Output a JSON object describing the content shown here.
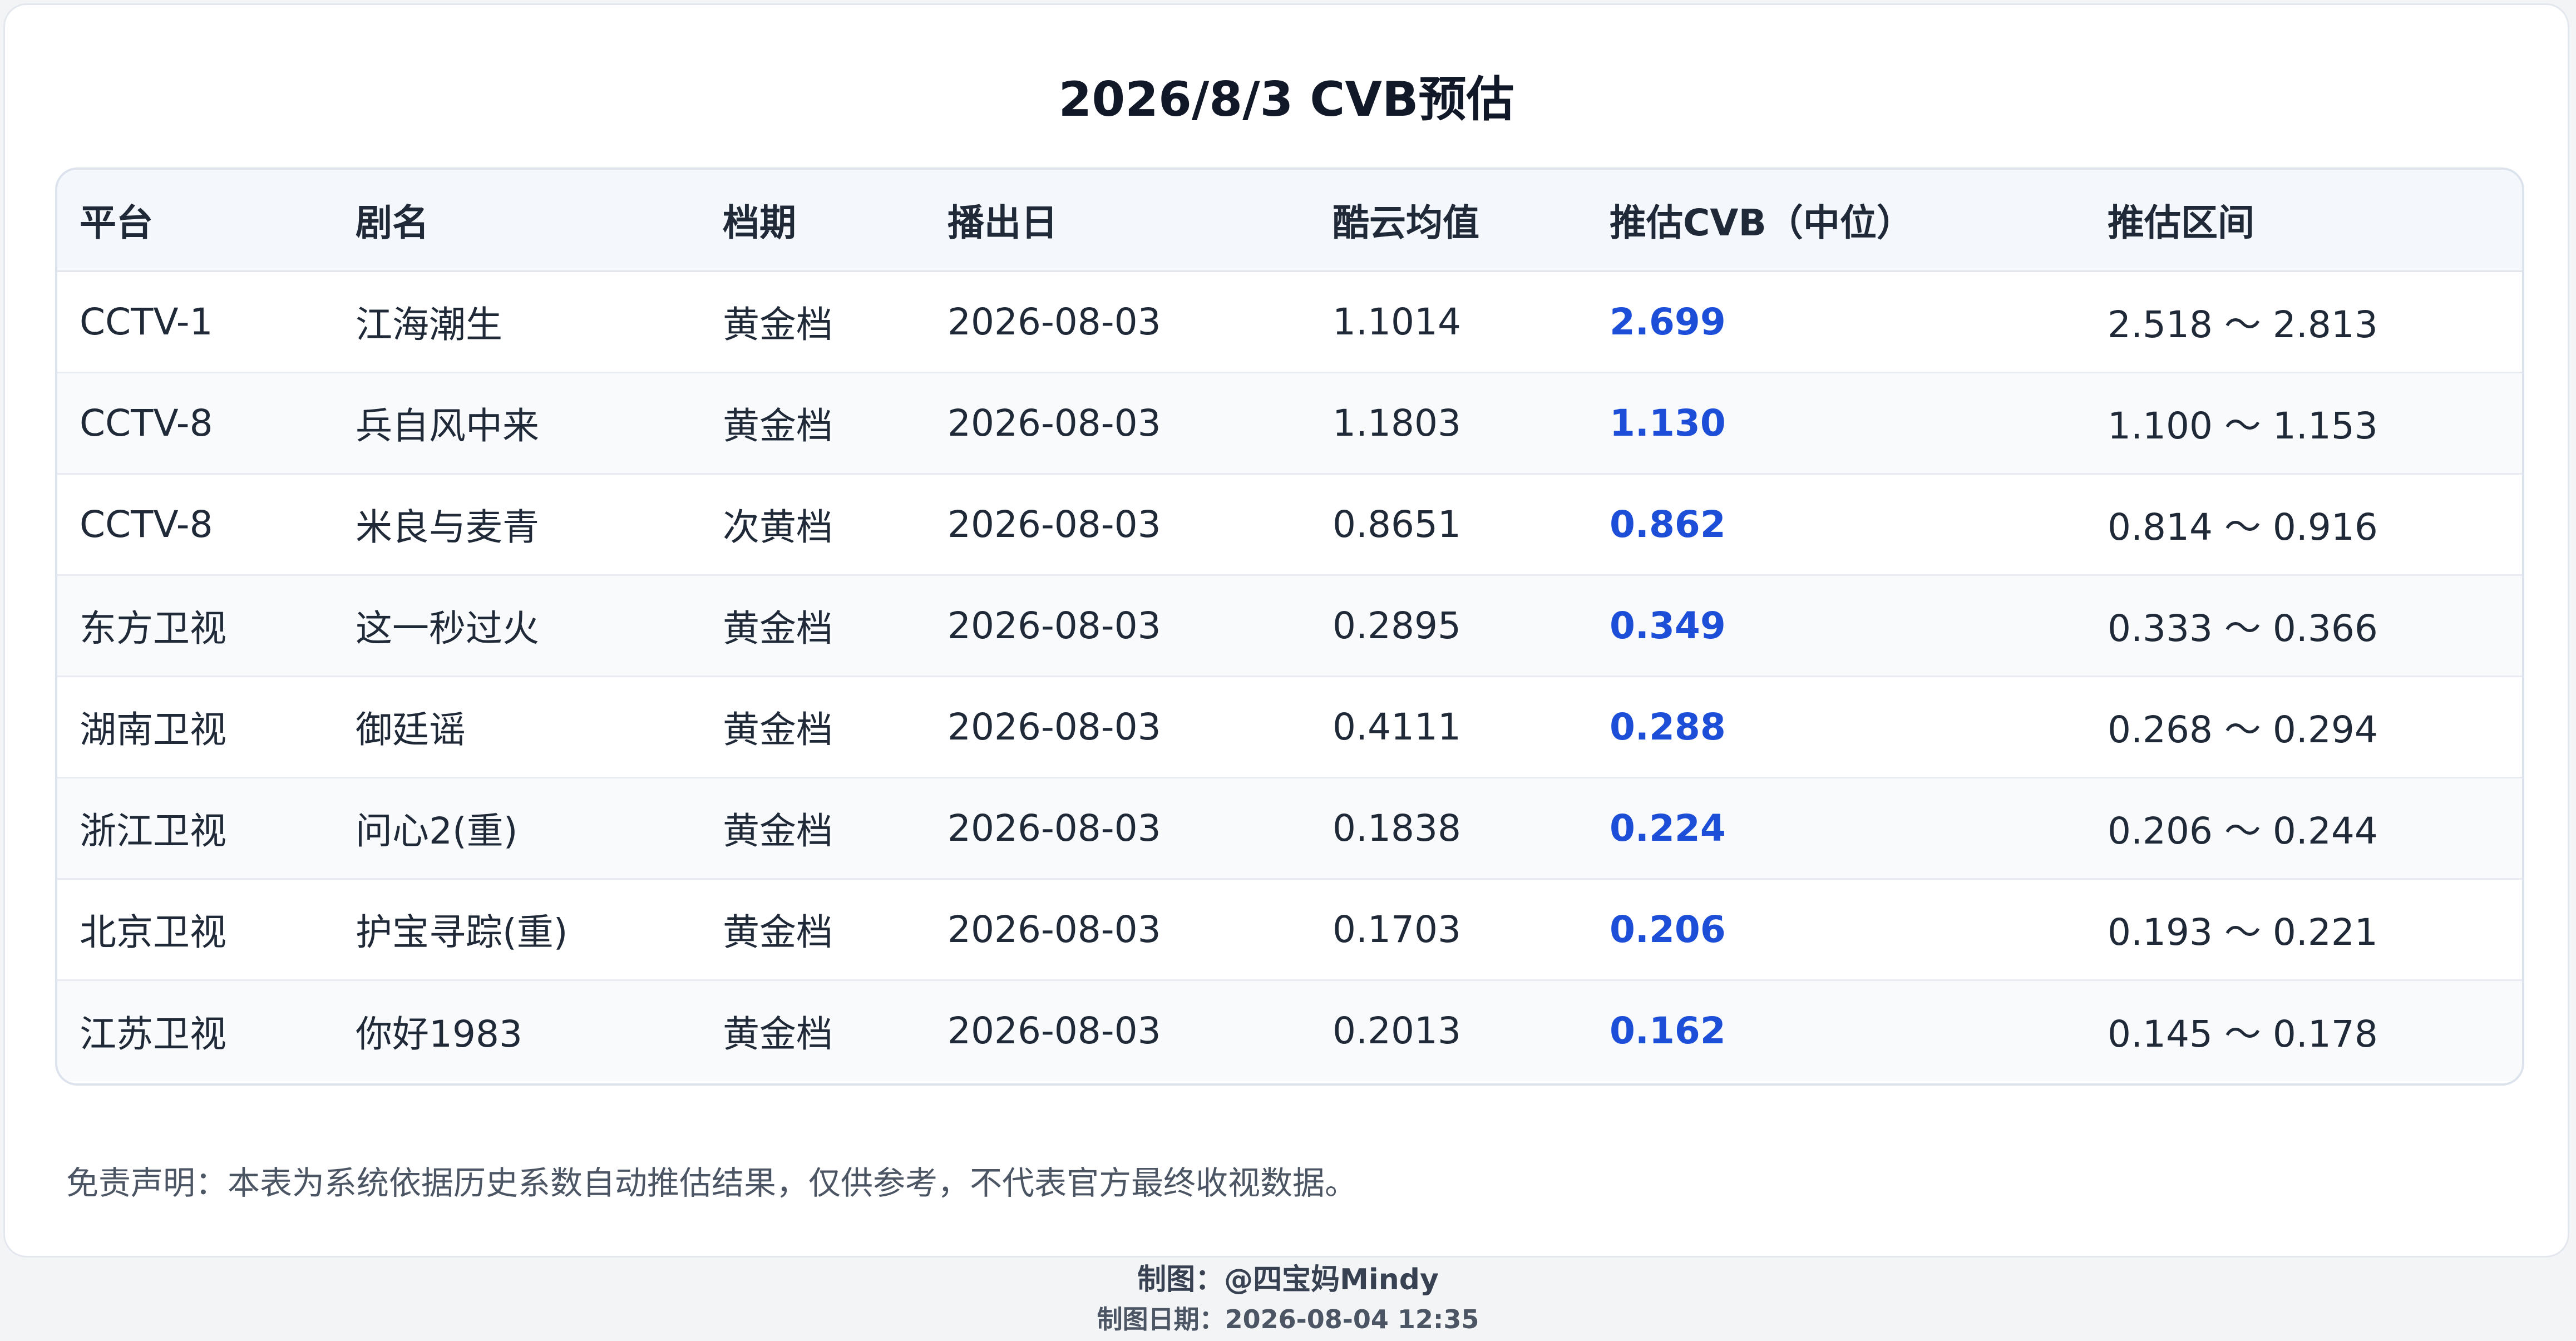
{
  "title": "2026/8/3 CVB预估",
  "table": {
    "headers": [
      "平台",
      "剧名",
      "档期",
      "播出日",
      "酷云均值",
      "推估CVB（中位）",
      "推估区间"
    ],
    "rows": [
      [
        "CCTV-1",
        "江海潮生",
        "黄金档",
        "2026-08-03",
        "1.1014",
        "2.699",
        "2.518 ～ 2.813"
      ],
      [
        "CCTV-8",
        "兵自风中来",
        "黄金档",
        "2026-08-03",
        "1.1803",
        "1.130",
        "1.100 ～ 1.153"
      ],
      [
        "CCTV-8",
        "米良与麦青",
        "次黄档",
        "2026-08-03",
        "0.8651",
        "0.862",
        "0.814 ～ 0.916"
      ],
      [
        "东方卫视",
        "这一秒过火",
        "黄金档",
        "2026-08-03",
        "0.2895",
        "0.349",
        "0.333 ～ 0.366"
      ],
      [
        "湖南卫视",
        "御廷谣",
        "黄金档",
        "2026-08-03",
        "0.4111",
        "0.288",
        "0.268 ～ 0.294"
      ],
      [
        "浙江卫视",
        "问心2(重)",
        "黄金档",
        "2026-08-03",
        "0.1838",
        "0.224",
        "0.206 ～ 0.244"
      ],
      [
        "北京卫视",
        "护宝寻踪(重)",
        "黄金档",
        "2026-08-03",
        "0.1703",
        "0.206",
        "0.193 ～ 0.221"
      ],
      [
        "江苏卫视",
        "你好1983",
        "黄金档",
        "2026-08-03",
        "0.2013",
        "0.162",
        "0.145 ～ 0.178"
      ]
    ]
  },
  "disclaimer": "免责声明：本表为系统依据历史系数自动推估结果，仅供参考，不代表官方最终收视数据。",
  "footer": {
    "maker": "制图：@四宝妈Mindy",
    "date": "制图日期：2026-08-04 12:35"
  },
  "colors": {
    "accent": "#1d4ed8",
    "header_bg": "#f4f7fb",
    "border": "#dde3ec"
  }
}
